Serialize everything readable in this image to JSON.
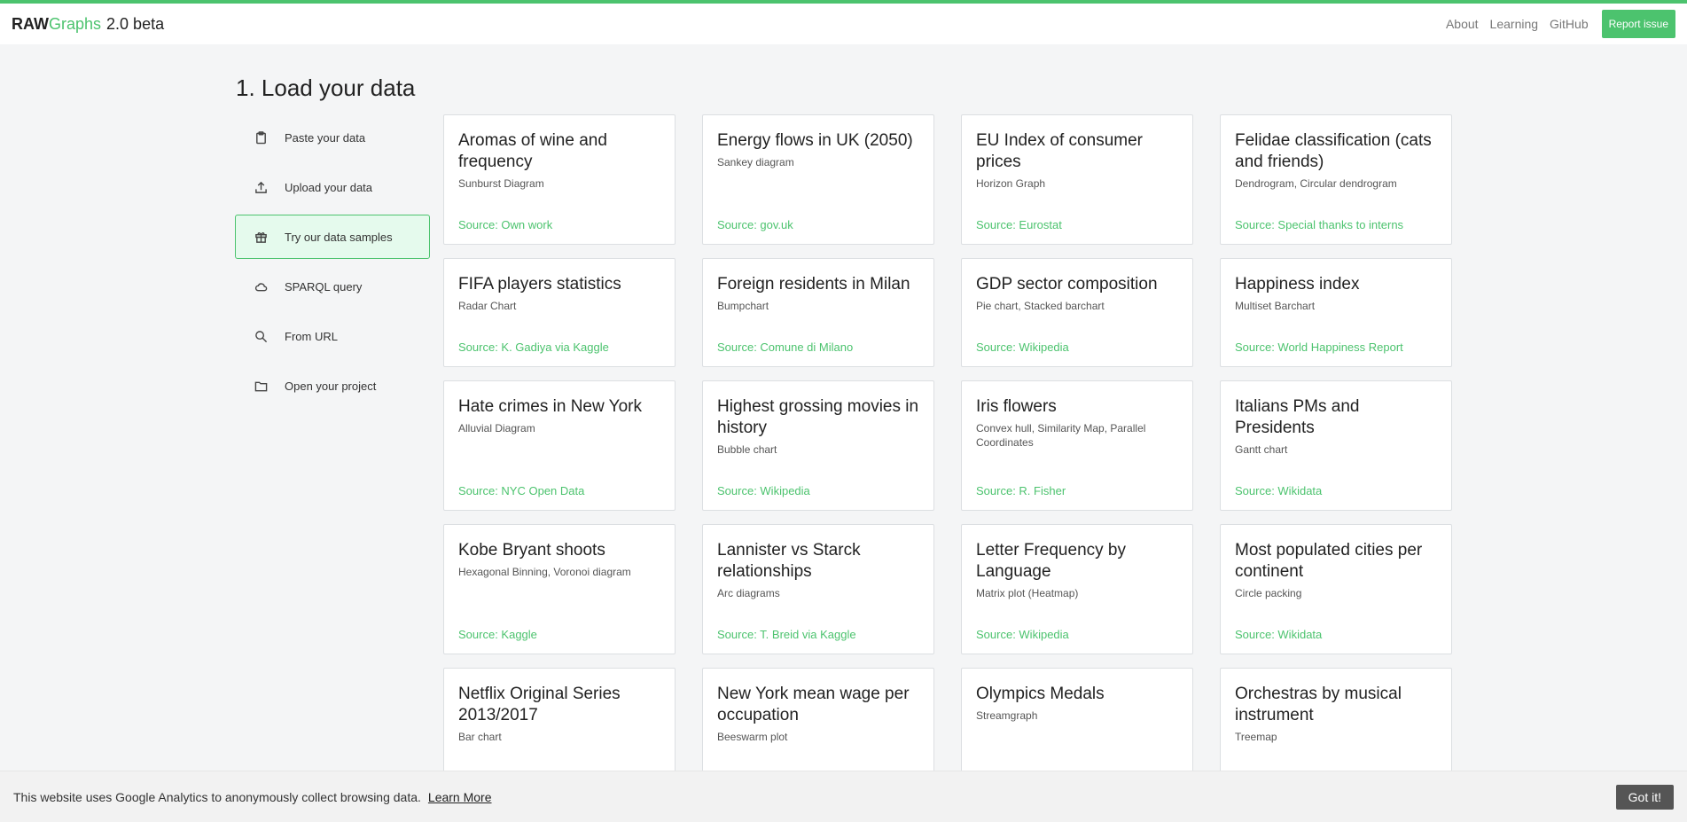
{
  "header": {
    "brand_raw": "RAW",
    "brand_graphs": "Graphs",
    "version": "2.0 beta",
    "nav": [
      "About",
      "Learning",
      "GitHub"
    ],
    "report_label": "Report issue",
    "accent_color": "#4cc36e"
  },
  "section": {
    "title": "1. Load your data"
  },
  "sidebar": {
    "items": [
      {
        "label": "Paste your data",
        "icon": "clipboard-icon",
        "active": false
      },
      {
        "label": "Upload your data",
        "icon": "upload-icon",
        "active": false
      },
      {
        "label": "Try our data samples",
        "icon": "gift-icon",
        "active": true
      },
      {
        "label": "SPARQL query",
        "icon": "cloud-icon",
        "active": false
      },
      {
        "label": "From URL",
        "icon": "search-icon",
        "active": false
      },
      {
        "label": "Open your project",
        "icon": "folder-icon",
        "active": false
      }
    ]
  },
  "samples": [
    {
      "title": "Aromas of wine and frequency",
      "charts": "Sunburst Diagram",
      "source": "Source: Own work"
    },
    {
      "title": "Energy flows in UK (2050)",
      "charts": "Sankey diagram",
      "source": "Source: gov.uk"
    },
    {
      "title": "EU Index of consumer prices",
      "charts": "Horizon Graph",
      "source": "Source: Eurostat"
    },
    {
      "title": "Felidae classification (cats and friends)",
      "charts": "Dendrogram, Circular dendrogram",
      "source": "Source: Special thanks to interns"
    },
    {
      "title": "FIFA players statistics",
      "charts": "Radar Chart",
      "source": "Source: K. Gadiya via Kaggle"
    },
    {
      "title": "Foreign residents in Milan",
      "charts": "Bumpchart",
      "source": "Source: Comune di Milano"
    },
    {
      "title": "GDP sector composition",
      "charts": "Pie chart, Stacked barchart",
      "source": "Source: Wikipedia"
    },
    {
      "title": "Happiness index",
      "charts": "Multiset Barchart",
      "source": "Source: World Happiness Report"
    },
    {
      "title": "Hate crimes in New York",
      "charts": "Alluvial Diagram",
      "source": "Source: NYC Open Data"
    },
    {
      "title": "Highest grossing movies in history",
      "charts": "Bubble chart",
      "source": "Source: Wikipedia"
    },
    {
      "title": "Iris flowers",
      "charts": "Convex hull, Similarity Map, Parallel Coordinates",
      "source": "Source: R. Fisher"
    },
    {
      "title": "Italians PMs and Presidents",
      "charts": "Gantt chart",
      "source": "Source: Wikidata"
    },
    {
      "title": "Kobe Bryant shoots",
      "charts": "Hexagonal Binning, Voronoi diagram",
      "source": "Source: Kaggle"
    },
    {
      "title": "Lannister vs Starck relationships",
      "charts": "Arc diagrams",
      "source": "Source: T. Breid via Kaggle"
    },
    {
      "title": "Letter Frequency by Language",
      "charts": "Matrix plot (Heatmap)",
      "source": "Source: Wikipedia"
    },
    {
      "title": "Most populated cities per continent",
      "charts": "Circle packing",
      "source": "Source: Wikidata"
    },
    {
      "title": "Netflix Original Series 2013/2017",
      "charts": "Bar chart",
      "source": ""
    },
    {
      "title": "New York mean wage per occupation",
      "charts": "Beeswarm plot",
      "source": ""
    },
    {
      "title": "Olympics Medals",
      "charts": "Streamgraph",
      "source": ""
    },
    {
      "title": "Orchestras by musical instrument",
      "charts": "Treemap",
      "source": ""
    }
  ],
  "cookie": {
    "message": "This website uses Google Analytics to anonymously collect browsing data.",
    "learn_more": "Learn More",
    "button": "Got it!"
  }
}
